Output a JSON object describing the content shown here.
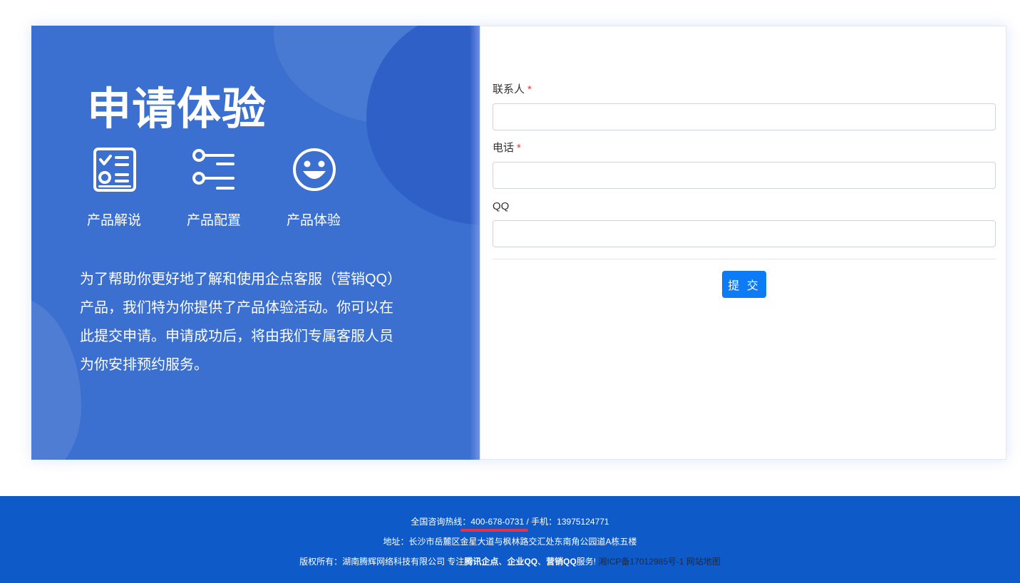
{
  "hero": {
    "title": "申请体验",
    "features": [
      {
        "icon": "checklist-icon",
        "label": "产品解说"
      },
      {
        "icon": "settings-list-icon",
        "label": "产品配置"
      },
      {
        "icon": "smiley-icon",
        "label": "产品体验"
      }
    ],
    "intro": "为了帮助你更好地了解和使用企点客服（营销QQ）产品，我们特为你提供了产品体验活动。你可以在此提交申请。申请成功后，将由我们专属客服人员为你安排预约服务。"
  },
  "form": {
    "fields": [
      {
        "label": "联系人",
        "required": true,
        "required_mark": "*",
        "value": ""
      },
      {
        "label": "电话",
        "required": true,
        "required_mark": "*",
        "value": ""
      },
      {
        "label": "QQ",
        "required": false,
        "value": ""
      }
    ],
    "submit_label": "提 交"
  },
  "footer": {
    "hotline_prefix": "全国咨询热线：",
    "hotline": "400-678-0731",
    "mobile_sep": " / 手机：",
    "mobile": "13975124771",
    "address": "地址：长沙市岳麓区金星大道与枫林路交汇处东南角公园道A栋五楼",
    "copyright_prefix": "版权所有：湖南腾辉网络科技有限公司 专注",
    "kw1": "腾讯企点",
    "sep1": "、",
    "kw2": "企业QQ",
    "sep2": "、",
    "kw3": "营销QQ",
    "copyright_suffix": "服务!",
    "icp": "湘ICP备17012985号-1",
    "sitemap": "网站地图"
  },
  "colors": {
    "panel_blue": "#3b6fd0",
    "footer_blue": "#0d5ac8",
    "submit_blue": "#0d7bf5",
    "required_red": "#e03c3c",
    "underline_red": "#e8314a"
  }
}
